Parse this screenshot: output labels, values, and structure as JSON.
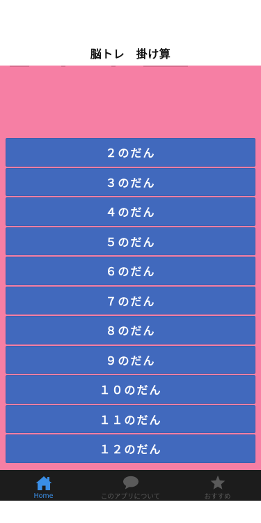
{
  "header": {
    "title": "脳トレ　掛け算"
  },
  "dan_buttons": [
    {
      "label": "２のだん"
    },
    {
      "label": "３のだん"
    },
    {
      "label": "４のだん"
    },
    {
      "label": "５のだん"
    },
    {
      "label": "６のだん"
    },
    {
      "label": "７のだん"
    },
    {
      "label": "８のだん"
    },
    {
      "label": "９のだん"
    },
    {
      "label": "１０のだん"
    },
    {
      "label": "１１のだん"
    },
    {
      "label": "１２のだん"
    }
  ],
  "tab_bar": {
    "tabs": [
      {
        "label": "Home",
        "icon": "home-icon",
        "active": true
      },
      {
        "label": "このアプリについて",
        "icon": "speech-bubble-icon",
        "active": false
      },
      {
        "label": "おすすめ",
        "icon": "star-icon",
        "active": false
      }
    ]
  },
  "colors": {
    "background_pink": "#f67fa4",
    "button_blue": "#4169bd",
    "tab_bar_bg": "#1c1c1c",
    "active_tab": "#3a8ee6",
    "inactive_tab": "#5a5a5a"
  }
}
